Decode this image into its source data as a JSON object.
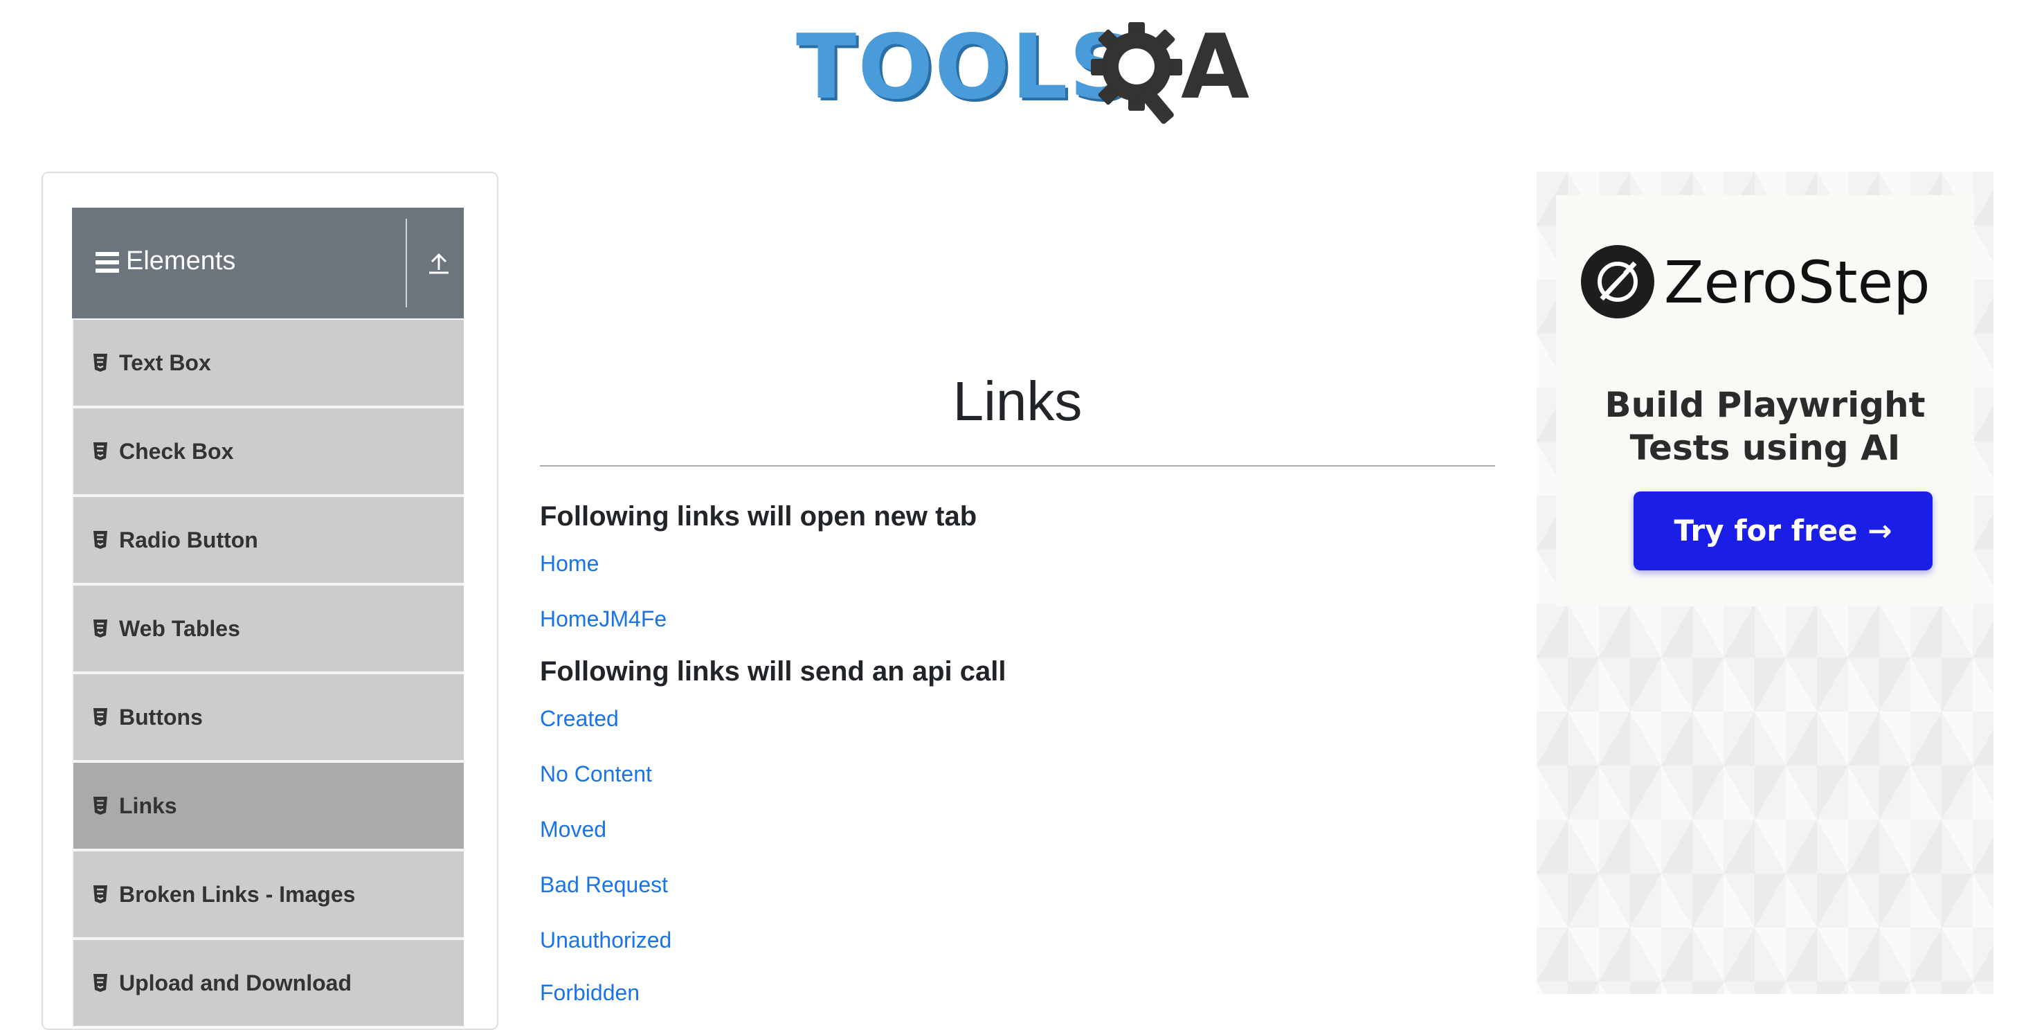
{
  "header": {
    "logo_text_left": "TOOLS",
    "logo_text_right": "A",
    "logo_colors": {
      "tools": "#4a9bd9",
      "qa": "#333333"
    }
  },
  "sidebar": {
    "group_title": "Elements",
    "group_header_color": "#6c757d",
    "items": [
      {
        "label": "Text Box",
        "active": false
      },
      {
        "label": "Check Box",
        "active": false
      },
      {
        "label": "Radio Button",
        "active": false
      },
      {
        "label": "Web Tables",
        "active": false
      },
      {
        "label": "Buttons",
        "active": false
      },
      {
        "label": "Links",
        "active": true
      },
      {
        "label": "Broken Links - Images",
        "active": false
      },
      {
        "label": "Upload and Download",
        "active": false
      }
    ]
  },
  "main": {
    "page_title": "Links",
    "section_new_tab": {
      "heading": "Following links will open new tab",
      "links": [
        "Home",
        "HomeJM4Fe"
      ]
    },
    "section_api": {
      "heading": "Following links will send an api call",
      "links": [
        "Created",
        "No Content",
        "Moved",
        "Bad Request",
        "Unauthorized",
        "Forbidden"
      ]
    },
    "link_color": "#1a73e8"
  },
  "ad": {
    "brand": "ZeroStep",
    "tagline_line1": "Build Playwright",
    "tagline_line2": "Tests using AI",
    "button_label": "Try for free →",
    "button_color": "#1a1ee6"
  }
}
